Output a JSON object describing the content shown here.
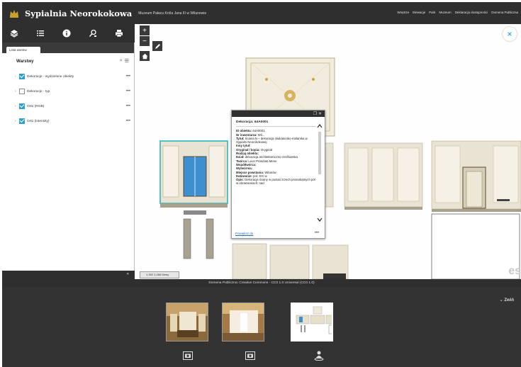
{
  "header": {
    "title": "Sypialnia Neorokokowa",
    "subtitle": "Muzeum Pałacu Króla Jana III w Wilanowie",
    "links": [
      "Wnętrze",
      "Elewacje",
      "Park",
      "Muzeum",
      "Deklaracja dostępności",
      "Domena Publiczna"
    ]
  },
  "toolbar": {
    "icons": [
      "layers-icon",
      "list-icon",
      "info-icon",
      "query-icon",
      "print-icon"
    ]
  },
  "layers_panel": {
    "tab_label": "Lista warstw",
    "title": "Warstwy",
    "layers": [
      {
        "label": "Dekoracje - wydzielone obiekty",
        "checked": true
      },
      {
        "label": "Dekoracje - typ",
        "checked": false
      },
      {
        "label": "Orto (RGB)",
        "checked": true
      },
      {
        "label": "Orto (intensity)",
        "checked": true
      }
    ],
    "more_label": "•••",
    "collapse_label": "«"
  },
  "map": {
    "zoom_in": "+",
    "zoom_out": "−",
    "close": "×",
    "scale_text": "1,392 2,068 Metry",
    "watermark": "es",
    "attribution": "Domena Publiczna: Creative Commons - CC0 1.0 Universal (CC0 1.0)"
  },
  "popup": {
    "title": "Dekoracja: 64A0001",
    "lines": [
      {
        "label": "ID obiektu:",
        "value": " 64A0001"
      },
      {
        "label": "Nr inwentarza:",
        "value": " Wil..."
      },
      {
        "label": "Tytuł:",
        "value": " Ściana N – dekoracja stiukatorsko-malarska w Sypialni Neorokokowej"
      },
      {
        "label": "Inny tytuł:",
        "value": ""
      },
      {
        "label": "Oryginał / kopia:",
        "value": " Oryginał"
      },
      {
        "label": "Rodzaj obiektu:",
        "value": ""
      },
      {
        "label": "Dział:",
        "value": " dekoracja architektoniczno-rzeźbiarska"
      },
      {
        "label": "Twórca:",
        "value": " Leon Prandota Mene"
      },
      {
        "label": "Współtwórca:",
        "value": ""
      },
      {
        "label": "Wytwórnia:",
        "value": ""
      },
      {
        "label": "Miejsce powstania:",
        "value": " Wilanów"
      },
      {
        "label": "Datowanie:",
        "value": " poł. XIX w."
      },
      {
        "label": "Opis:",
        "value": " Dekoracja ściany w postaci trzech prostokątnych pól w obramieniach; nad"
      }
    ],
    "link_label": "Powiększ do",
    "more": "•••"
  },
  "bottom": {
    "collapse_label": "Zwiń"
  }
}
